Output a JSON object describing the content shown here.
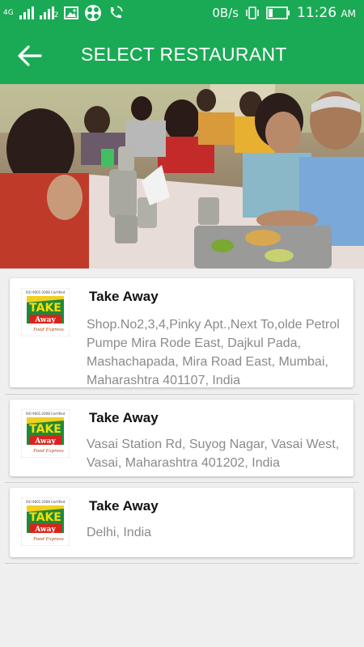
{
  "status_bar": {
    "network": "4G",
    "sim2": "2",
    "net_speed": "0B/s",
    "time": "11:26",
    "ampm": "AM",
    "icons": [
      "signal-icon",
      "signal-icon",
      "image-icon",
      "app-icon",
      "wifi-calling-icon",
      "vibrate-icon",
      "battery-icon"
    ]
  },
  "header": {
    "title": "SELECT RESTAURANT",
    "back_icon": "arrow-left-icon",
    "color": "#1aaa55"
  },
  "restaurants": [
    {
      "name": "Take Away",
      "address": "Shop.No2,3,4,Pinky Apt.,Next To,olde Petrol Pumpe Mira Rode East, Dajkul Pada, Mashachapada, Mira Road East, Mumbai, Maharashtra 401107, India"
    },
    {
      "name": "Take Away",
      "address": "Vasai Station Rd, Suyog Nagar, Vasai West, Vasai, Maharashtra 401202, India"
    },
    {
      "name": "Take Away",
      "address": "Delhi, India"
    }
  ],
  "logo": {
    "certified": "ISO 9001:2008 Certified",
    "word1": "TAKE",
    "word2": "Away",
    "tagline": "Food Express"
  }
}
